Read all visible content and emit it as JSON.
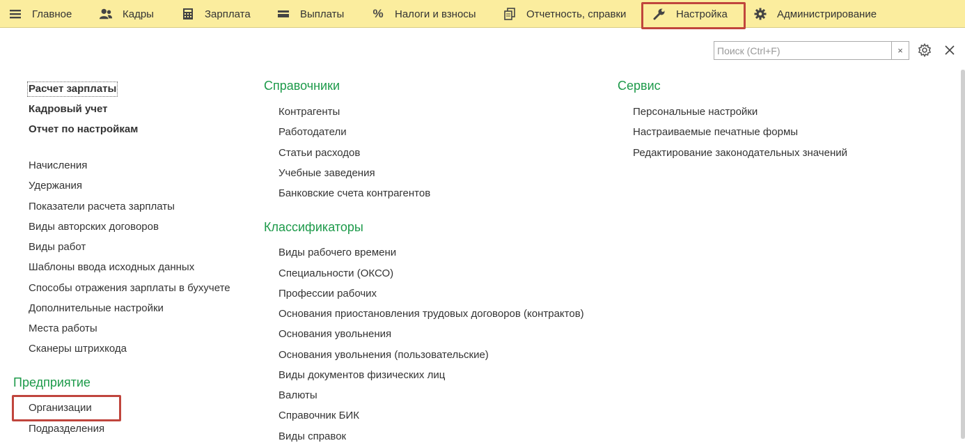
{
  "topbar": {
    "items": [
      {
        "label": "Главное",
        "icon": "menu-icon"
      },
      {
        "label": "Кадры",
        "icon": "users-icon"
      },
      {
        "label": "Зарплата",
        "icon": "calculator-icon"
      },
      {
        "label": "Выплаты",
        "icon": "wallet-icon"
      },
      {
        "label": "Налоги и взносы",
        "icon": "percent-icon"
      },
      {
        "label": "Отчетность, справки",
        "icon": "documents-icon"
      },
      {
        "label": "Настройка",
        "icon": "wrench-icon"
      },
      {
        "label": "Администрирование",
        "icon": "gear-icon"
      }
    ],
    "active": "Настройка",
    "background": "#fbed9e"
  },
  "search": {
    "placeholder": "Поиск (Ctrl+F)",
    "value": "",
    "clear_label": "×"
  },
  "column1": {
    "main": [
      "Расчет зарплаты",
      "Кадровый учет",
      "Отчет по настройкам"
    ],
    "items": [
      "Начисления",
      "Удержания",
      "Показатели расчета зарплаты",
      "Виды авторских договоров",
      "Виды работ",
      "Шаблоны ввода исходных данных",
      "Способы отражения зарплаты в бухучете",
      "Дополнительные настройки",
      "Места работы",
      "Сканеры штрихкода"
    ],
    "section_title": "Предприятие",
    "section_items": [
      "Организации",
      "Подразделения"
    ]
  },
  "column2": {
    "section1_title": "Справочники",
    "section1_items": [
      "Контрагенты",
      "Работодатели",
      "Статьи расходов",
      "Учебные заведения",
      "Банковские счета контрагентов"
    ],
    "section2_title": "Классификаторы",
    "section2_items": [
      "Виды рабочего времени",
      "Специальности (ОКСО)",
      "Профессии рабочих",
      "Основания приостановления трудовых договоров (контрактов)",
      "Основания увольнения",
      "Основания увольнения (пользовательские)",
      "Виды документов физических лиц",
      "Валюты",
      "Справочник БИК",
      "Виды справок"
    ]
  },
  "column3": {
    "section_title": "Сервис",
    "items": [
      "Персональные настройки",
      "Настраиваемые печатные формы",
      "Редактирование законодательных значений"
    ]
  },
  "colors": {
    "section_title": "#1d9a4a",
    "highlight": "#c0453d"
  }
}
